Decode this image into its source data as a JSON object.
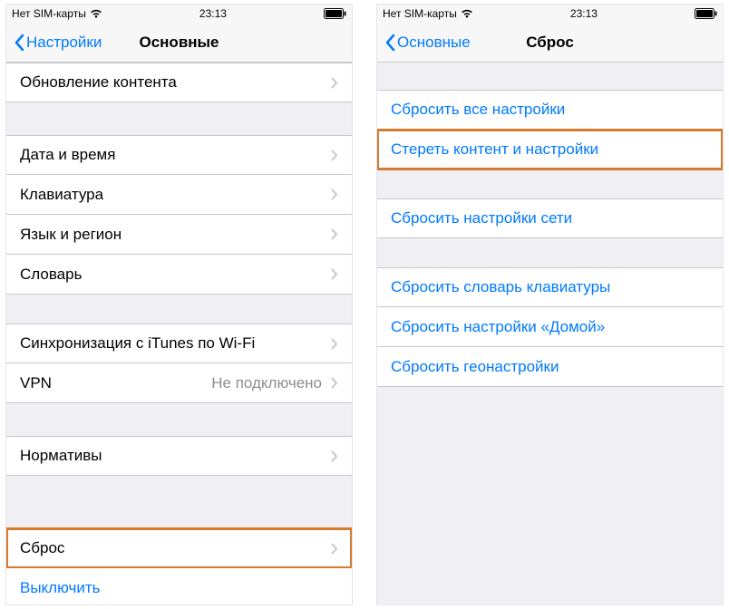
{
  "status": {
    "carrier": "Нет SIM-карты",
    "time": "23:13"
  },
  "left": {
    "back": "Настройки",
    "title": "Основные",
    "groups": [
      {
        "rows": [
          {
            "label": "Обновление контента",
            "chevron": true
          }
        ],
        "partialTop": true
      },
      {
        "rows": [
          {
            "label": "Дата и время",
            "chevron": true
          },
          {
            "label": "Клавиатура",
            "chevron": true
          },
          {
            "label": "Язык и регион",
            "chevron": true
          },
          {
            "label": "Словарь",
            "chevron": true
          }
        ]
      },
      {
        "rows": [
          {
            "label": "Синхронизация с iTunes по Wi-Fi",
            "chevron": true
          },
          {
            "label": "VPN",
            "detail": "Не подключено",
            "chevron": true
          }
        ]
      },
      {
        "rows": [
          {
            "label": "Нормативы",
            "chevron": true
          }
        ]
      },
      {
        "rows": [
          {
            "label": "Сброс",
            "chevron": true,
            "highlight": true
          },
          {
            "label": "Выключить",
            "action": true
          }
        ]
      }
    ]
  },
  "right": {
    "back": "Основные",
    "title": "Сброс",
    "groups": [
      {
        "rows": [
          {
            "label": "Сбросить все настройки",
            "action": true
          },
          {
            "label": "Стереть контент и настройки",
            "action": true,
            "highlight": true
          }
        ]
      },
      {
        "rows": [
          {
            "label": "Сбросить настройки сети",
            "action": true
          }
        ]
      },
      {
        "rows": [
          {
            "label": "Сбросить словарь клавиатуры",
            "action": true
          },
          {
            "label": "Сбросить настройки «Домой»",
            "action": true
          },
          {
            "label": "Сбросить геонастройки",
            "action": true
          }
        ]
      }
    ]
  }
}
